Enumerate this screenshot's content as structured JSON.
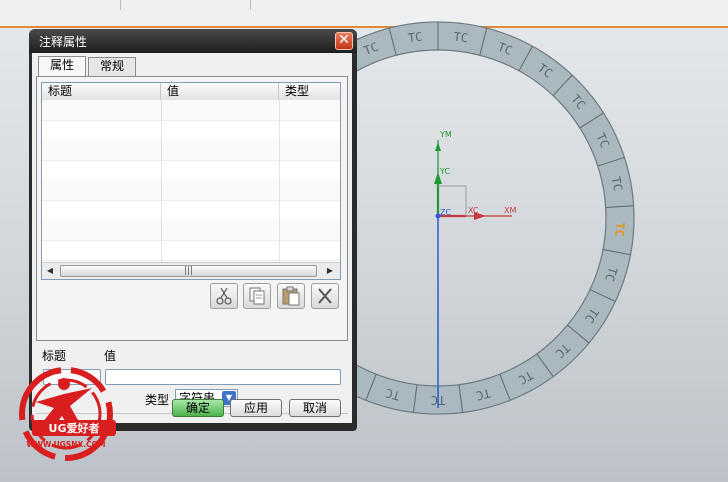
{
  "dialog": {
    "title": "注释属性",
    "tabs": [
      {
        "label": "属性",
        "active": true
      },
      {
        "label": "常规",
        "active": false
      }
    ],
    "table": {
      "columns": [
        "标题",
        "值",
        "类型"
      ],
      "rows": []
    },
    "toolbar": [
      {
        "icon": "scissors-cut-icon"
      },
      {
        "icon": "copy-icon"
      },
      {
        "icon": "paste-icon"
      },
      {
        "icon": "delete-x-icon"
      }
    ],
    "title_field_label": "标题",
    "value_field_label": "值",
    "title_value": "",
    "value_value": "",
    "type_label": "类型",
    "type_selected": "字符串",
    "ok_label": "确定",
    "apply_label": "应用",
    "cancel_label": "取消"
  },
  "viewport": {
    "ring_text": [
      "TC",
      "TC",
      "TC",
      "TC",
      "TC",
      "TC",
      "TC",
      "TC",
      "TC",
      "TC",
      "TC",
      "TC",
      "TC",
      "TC",
      "TC",
      "TC",
      "TC",
      "TC",
      "TC",
      "TC",
      "TC",
      "TC",
      "TC",
      "TC",
      "TC"
    ],
    "highlighted_ring_text": "TC",
    "axis_labels": {
      "ym": "YM",
      "yc": "YC",
      "xc": "XC",
      "xm": "XM",
      "zc": "ZC"
    },
    "colors": {
      "ring": "#aab8bf",
      "selected_text": "#e8901e",
      "axis_y": "#1c9a32",
      "axis_x": "#c83a3a",
      "axis_z": "#2b5bd6"
    }
  },
  "watermark": {
    "brand": "UG爱好者",
    "url": "WWW.UGSNX.COM",
    "color": "#d81e1e"
  }
}
